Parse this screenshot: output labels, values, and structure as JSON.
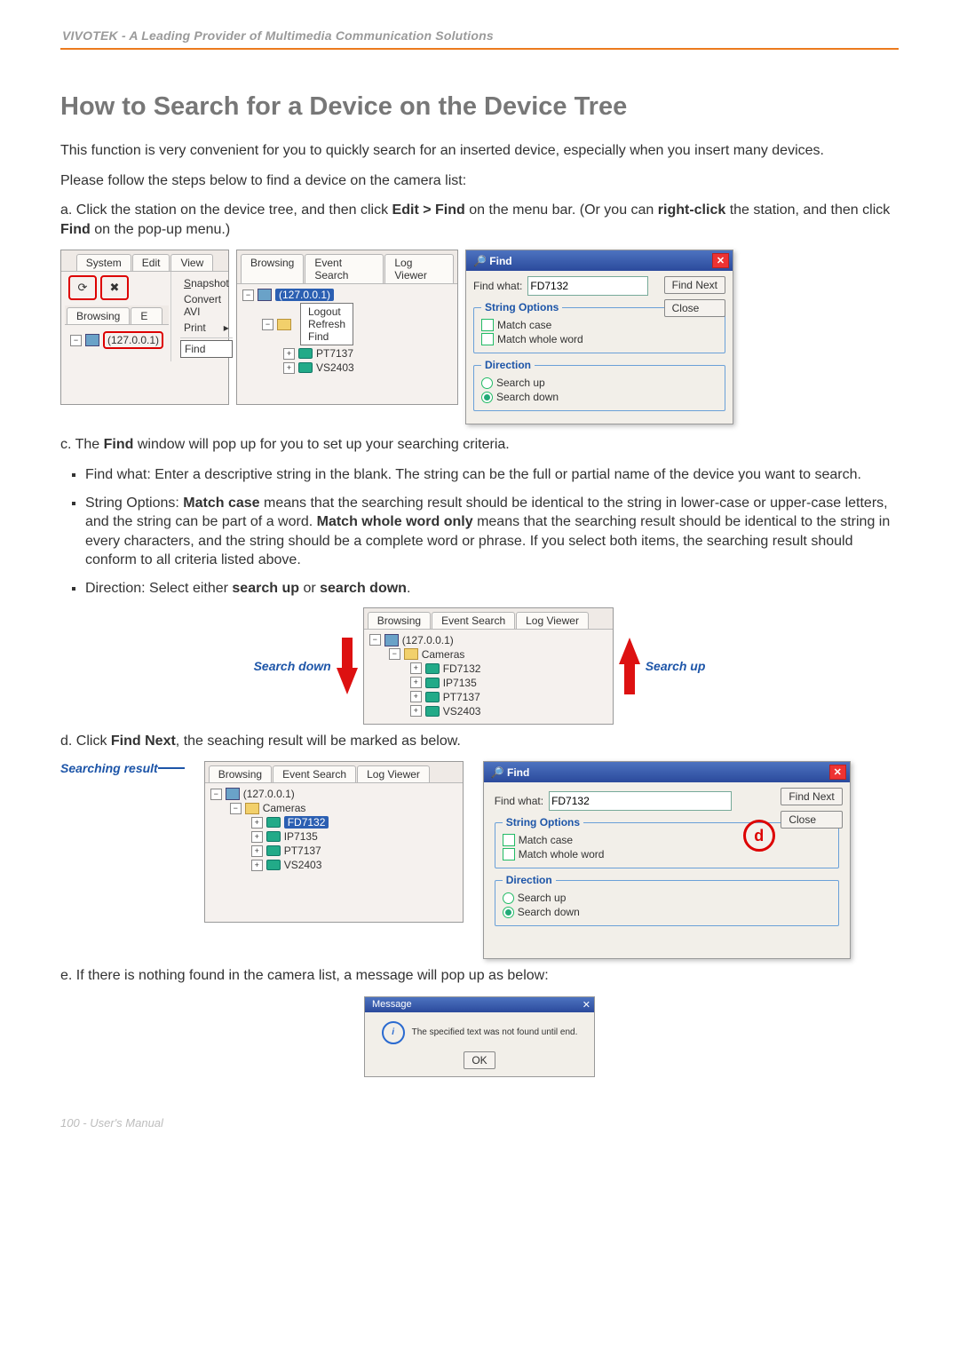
{
  "header": "VIVOTEK - A Leading Provider of Multimedia Communication Solutions",
  "title": "How to Search for a Device on the Device Tree",
  "intro1": "This function is very convenient for you to quickly search for an inserted device, especially when you insert many devices.",
  "intro2": "Please follow the steps below to find a device on the camera list:",
  "step_a_1": "a. Click the station on the device tree, and then click ",
  "step_a_bold1": "Edit > Find",
  "step_a_2": " on the menu bar. (Or you can ",
  "step_a_bold2": "right-click",
  "step_a_3": " the station, and then click ",
  "step_a_bold3": "Find",
  "step_a_4": " on the pop-up menu.)",
  "tabs": {
    "system": "System",
    "edit": "Edit",
    "view": "View",
    "browsing": "Browsing",
    "eventsearch": "Event Search",
    "logviewer": "Log Viewer"
  },
  "menu": {
    "snapshot": "Snapshot",
    "convert": "Convert AVI",
    "print": "Print",
    "find": "Find"
  },
  "ctx": {
    "logout": "Logout",
    "refresh": "Refresh",
    "find": "Find"
  },
  "station_ip": "(127.0.0.1)",
  "cameras_node": "Cameras",
  "cam": {
    "fd7132": "FD7132",
    "ip7135": "IP7135",
    "pt7137": "PT7137",
    "vs2403": "VS2403"
  },
  "find": {
    "title": "Find",
    "what_label": "Find what:",
    "what_value": "FD7132",
    "group_string": "String Options",
    "match_case": "Match case",
    "match_whole": "Match whole word",
    "group_dir": "Direction",
    "search_up": "Search up",
    "search_down": "Search down",
    "find_next": "Find Next",
    "close": "Close"
  },
  "step_c_1": "c. The ",
  "step_c_bold": "Find",
  "step_c_2": " window will pop up for you to set up your searching criteria.",
  "bullet_findwhat": "Find what: Enter a descriptive string in the blank. The string can be the full or partial name of the device you want to search.",
  "bullet_string_1": "String Options: ",
  "bullet_string_b1": "Match case",
  "bullet_string_2": " means that the searching result should be identical to the string in lower-case or upper-case letters, and the string can be part of a word. ",
  "bullet_string_b2": "Match whole word only",
  "bullet_string_3": " means that the searching result should be identical to the string in every characters, and the string should be a complete word or phrase. If you select both items, the searching result should conform to all criteria listed above.",
  "bullet_dir_1": "Direction: Select either ",
  "bullet_dir_b1": "search up",
  "bullet_dir_2": " or ",
  "bullet_dir_b2": "search down",
  "bullet_dir_3": ".",
  "label_search_down": "Search down",
  "label_search_up": "Search up",
  "step_d_1": "d. Click ",
  "step_d_bold": "Find Next",
  "step_d_2": ", the seaching result will be marked as below.",
  "label_searching_result": "Searching result",
  "circle_d": "d",
  "step_e": "e. If there is nothing found in the camera list, a message will pop up as below:",
  "msg": {
    "title": "Message",
    "text": "The specified text was not found until end.",
    "ok": "OK"
  },
  "footer": "100 - User's Manual"
}
